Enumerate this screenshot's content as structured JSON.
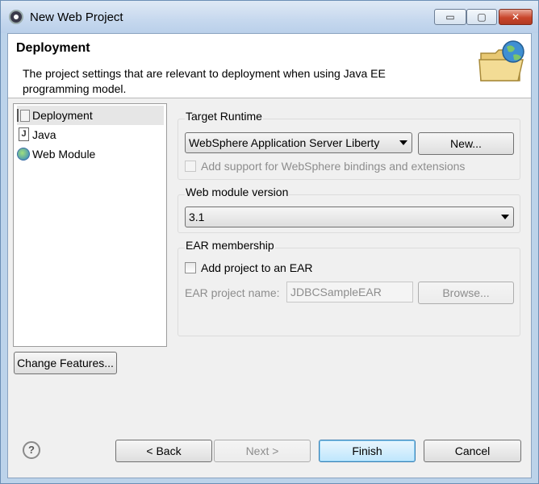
{
  "window": {
    "title": "New Web Project",
    "controls": {
      "minimize": "▭",
      "maximize": "▢",
      "close": "✕"
    }
  },
  "header": {
    "title": "Deployment",
    "description": "The project settings that are relevant to deployment when using Java EE programming model."
  },
  "tree": {
    "items": [
      {
        "label": "Deployment",
        "icon": "deployment-icon",
        "selected": true
      },
      {
        "label": "Java",
        "icon": "java-file-icon",
        "selected": false
      },
      {
        "label": "Web Module",
        "icon": "web-module-icon",
        "selected": false
      }
    ]
  },
  "change_features_label": "Change Features...",
  "target_runtime": {
    "label": "Target Runtime",
    "selected": "WebSphere Application Server Liberty",
    "new_button": "New...",
    "bindings_checkbox": {
      "label": "Add support for WebSphere bindings and extensions",
      "checked": false,
      "enabled": false
    }
  },
  "web_module_version": {
    "label": "Web module version",
    "selected": "3.1"
  },
  "ear_membership": {
    "label": "EAR membership",
    "add_checkbox": {
      "label": "Add project to an EAR",
      "checked": false
    },
    "project_name_label": "EAR project name:",
    "project_name_value": "JDBCSampleEAR",
    "browse_button": "Browse..."
  },
  "footer": {
    "help": "?",
    "back": "< Back",
    "next": "Next >",
    "finish": "Finish",
    "cancel": "Cancel"
  },
  "colors": {
    "title_bar": "#c6d8ee",
    "close_button": "#c9462c",
    "default_button": "#bee6fd",
    "dialog_background": "#f0f0f0"
  }
}
